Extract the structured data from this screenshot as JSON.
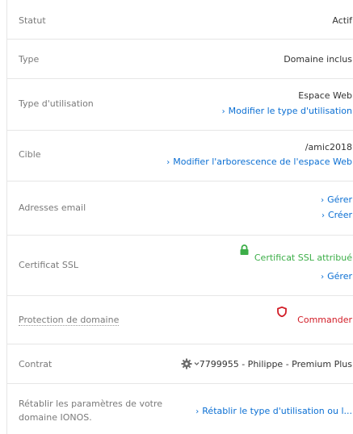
{
  "rows": {
    "statut": {
      "label": "Statut",
      "value": "Actif"
    },
    "type": {
      "label": "Type",
      "value": "Domaine inclus"
    },
    "type_utilisation": {
      "label": "Type d'utilisation",
      "value": "Espace Web",
      "link": "Modifier le type d'utilisation"
    },
    "cible": {
      "label": "Cible",
      "value": "/amic2018",
      "link": "Modifier l'arborescence de l'espace Web"
    },
    "adresses_email": {
      "label": "Adresses email",
      "link_manage": "Gérer",
      "link_create": "Créer"
    },
    "ssl": {
      "label": "Certificat SSL",
      "status": "Certificat SSL attribué",
      "link_manage": "Gérer",
      "status_color": "#3cae48"
    },
    "protection": {
      "label": "Protection de domaine",
      "action": "Commander",
      "action_color": "#d21d27"
    },
    "contrat": {
      "label": "Contrat",
      "value": "7799955 - Philippe - Premium Plus"
    },
    "reset": {
      "label_line1": "Rétablir les paramètres de votre",
      "label_line2": "domaine IONOS.",
      "link": "Rétablir le type d'utilisation ou l..."
    }
  },
  "colors": {
    "link": "#0b6fd3",
    "border": "#e6e6e6",
    "label": "#7a7a7a"
  },
  "icons": [
    "lock-icon",
    "shield-icon",
    "gear-icon",
    "chevron-down-icon",
    "chevron-right-icon"
  ]
}
